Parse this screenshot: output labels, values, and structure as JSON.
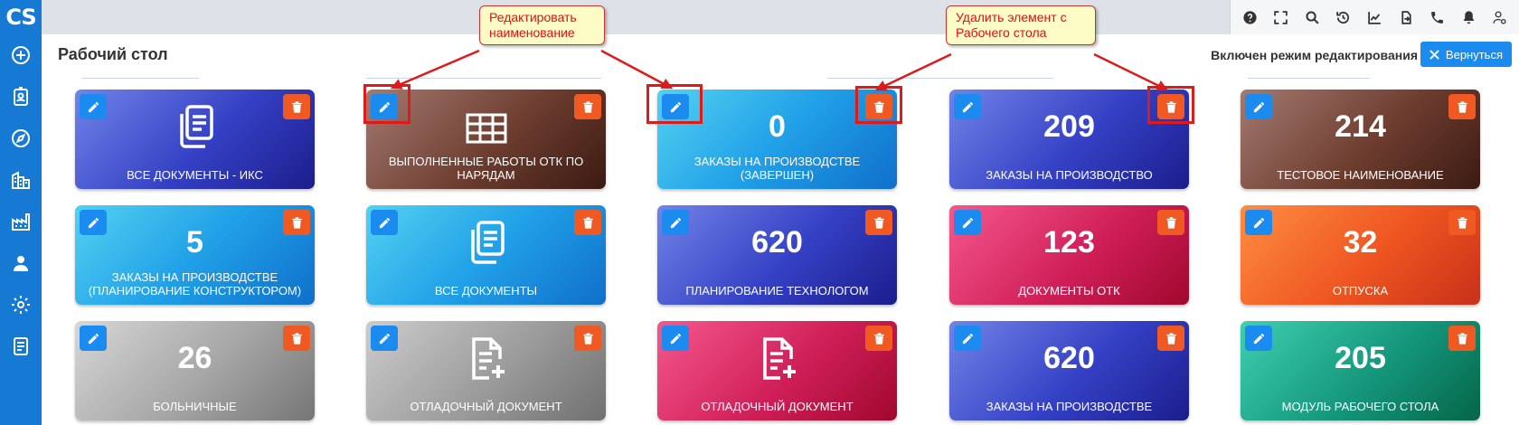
{
  "sidebar": {
    "logo": "CS",
    "items": [
      {
        "name": "add",
        "icon": "plus-circle-icon"
      },
      {
        "name": "contacts",
        "icon": "id-badge-icon"
      },
      {
        "name": "navigation",
        "icon": "compass-icon"
      },
      {
        "name": "organizations",
        "icon": "buildings-icon"
      },
      {
        "name": "production",
        "icon": "factory-icon"
      },
      {
        "name": "users",
        "icon": "users-icon"
      },
      {
        "name": "settings",
        "icon": "gear-icon"
      },
      {
        "name": "documents",
        "icon": "document-icon"
      }
    ]
  },
  "toolbar": [
    {
      "name": "help",
      "icon": "help-icon"
    },
    {
      "name": "fullscreen",
      "icon": "fullscreen-icon"
    },
    {
      "name": "search",
      "icon": "search-icon"
    },
    {
      "name": "history",
      "icon": "history-icon"
    },
    {
      "name": "chart",
      "icon": "chart-icon"
    },
    {
      "name": "export",
      "icon": "export-icon"
    },
    {
      "name": "phone",
      "icon": "phone-icon"
    },
    {
      "name": "notifications",
      "icon": "bell-icon"
    },
    {
      "name": "user",
      "icon": "user-settings-icon"
    }
  ],
  "header": {
    "title": "Рабочий стол",
    "mode_text": "Включен режим редактирования",
    "return_label": "Вернуться"
  },
  "tiles": [
    {
      "label": "ВСЕ ДОКУМЕНТЫ - ИКС",
      "value": "",
      "icon": "documents-icon",
      "gradient": "indigo"
    },
    {
      "label": "ВЫПОЛНЕННЫЕ РАБОТЫ ОТК ПО НАРЯДАМ",
      "value": "",
      "icon": "table-icon",
      "gradient": "brown"
    },
    {
      "label": "ЗАКАЗЫ НА ПРОИЗВОДСТВЕ (ЗАВЕРШЕН)",
      "value": "0",
      "icon": "",
      "gradient": "sky"
    },
    {
      "label": "ЗАКАЗЫ НА ПРОИЗВОДСТВО",
      "value": "209",
      "icon": "",
      "gradient": "indigo"
    },
    {
      "label": "ТЕСТОВОЕ НАИМЕНОВАНИЕ",
      "value": "214",
      "icon": "",
      "gradient": "brown"
    },
    {
      "label": "ЗАКАЗЫ НА ПРОИЗВОДСТВЕ (ПЛАНИРОВАНИЕ КОНСТРУКТОРОМ)",
      "value": "5",
      "icon": "",
      "gradient": "sky"
    },
    {
      "label": "ВСЕ ДОКУМЕНТЫ",
      "value": "",
      "icon": "documents-icon",
      "gradient": "sky"
    },
    {
      "label": "ПЛАНИРОВАНИЕ ТЕХНОЛОГОМ",
      "value": "620",
      "icon": "",
      "gradient": "indigo"
    },
    {
      "label": "ДОКУМЕНТЫ ОТК",
      "value": "123",
      "icon": "",
      "gradient": "pink"
    },
    {
      "label": "ОТПУСКА",
      "value": "32",
      "icon": "",
      "gradient": "orange"
    },
    {
      "label": "БОЛЬНИЧНЫЕ",
      "value": "26",
      "icon": "",
      "gradient": "gray"
    },
    {
      "label": "ОТЛАДОЧНЫЙ ДОКУМЕНТ",
      "value": "",
      "icon": "file-plus-icon",
      "gradient": "grayd"
    },
    {
      "label": "ОТЛАДОЧНЫЙ ДОКУМЕНТ",
      "value": "",
      "icon": "file-plus-icon",
      "gradient": "pink"
    },
    {
      "label": "ЗАКАЗЫ НА ПРОИЗВОДСТВЕ",
      "value": "620",
      "icon": "",
      "gradient": "indigo"
    },
    {
      "label": "МОДУЛЬ РАБОЧЕГО СТОЛА",
      "value": "205",
      "icon": "",
      "gradient": "teal"
    }
  ],
  "annotations": {
    "edit_callout": "Редактировать наименование",
    "delete_callout": "Удалить элемент с Рабочего стола"
  },
  "colors": {
    "sidebar": "#1679d4",
    "edit_button": "#1c8bf0",
    "delete_button": "#f05a22",
    "annotation_border": "#dd1b1b"
  }
}
